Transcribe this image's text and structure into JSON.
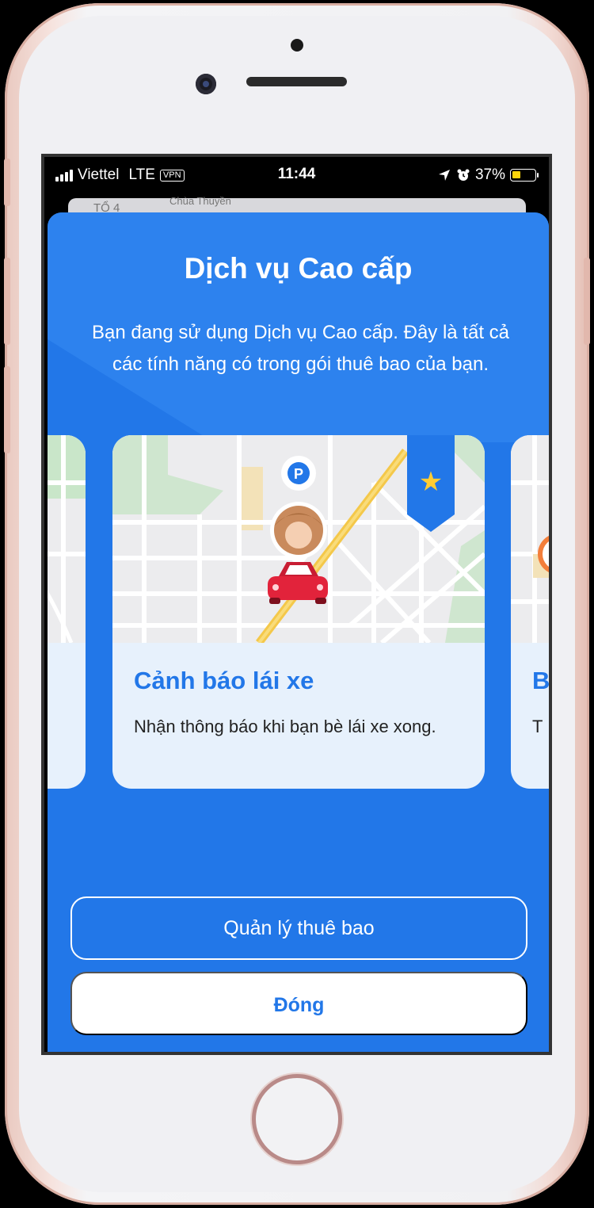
{
  "status_bar": {
    "carrier": "Viettel",
    "network": "LTE",
    "vpn_label": "VPN",
    "time": "11:44",
    "battery_percent": "37%",
    "battery_level": 0.37,
    "battery_color": "#ffd60a"
  },
  "background_map": {
    "label_1": "TỔ 4",
    "label_2": "Chùa Thuyền"
  },
  "modal": {
    "title": "Dịch vụ Cao cấp",
    "description": "Bạn đang sử dụng Dịch vụ Cao cấp. Đây là tất cả các tính năng có trong gói thuê bao của bạn.",
    "accent_color": "#2277e8"
  },
  "cards": {
    "main": {
      "title": "Cảnh báo lái xe",
      "text": "Nhận thông báo khi bạn bè lái xe xong.",
      "parking_label": "P"
    },
    "right": {
      "title_peek": "B",
      "text_peek": "T"
    }
  },
  "buttons": {
    "manage_label": "Quản lý thuê bao",
    "close_label": "Đóng"
  }
}
